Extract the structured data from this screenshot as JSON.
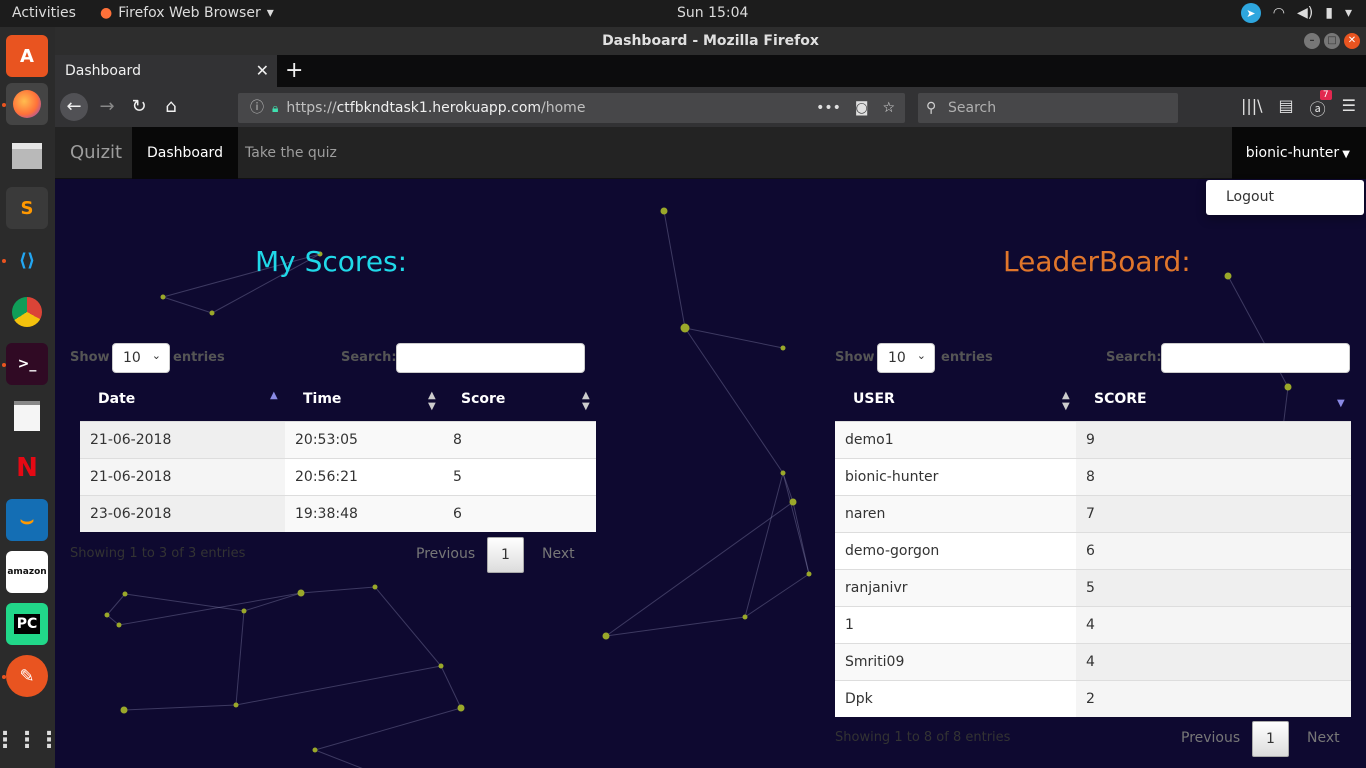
{
  "desktop": {
    "activities": "Activities",
    "app_menu": "Firefox Web Browser",
    "clock": "Sun 15:04"
  },
  "firefox": {
    "window_title": "Dashboard - Mozilla Firefox",
    "tab_title": "Dashboard",
    "url_scheme": "https://",
    "url_host": "ctfbkndtask1.herokuapp.com",
    "url_path": "/home",
    "search_placeholder": "Search",
    "addon_badge": "7"
  },
  "app": {
    "brand": "Quizit",
    "nav": [
      "Dashboard",
      "Take the quiz"
    ],
    "user": "bionic-hunter",
    "dropdown_logout": "Logout"
  },
  "my_scores": {
    "heading": "My Scores:",
    "show": "Show",
    "entries_count": "10",
    "entries": "entries",
    "search_label": "Search:",
    "columns": [
      "Date",
      "Time",
      "Score"
    ],
    "rows": [
      [
        "21-06-2018",
        "20:53:05",
        "8"
      ],
      [
        "21-06-2018",
        "20:56:21",
        "5"
      ],
      [
        "23-06-2018",
        "19:38:48",
        "6"
      ]
    ],
    "info": "Showing 1 to 3 of 3 entries",
    "previous": "Previous",
    "page": "1",
    "next": "Next"
  },
  "leaderboard": {
    "heading": "LeaderBoard:",
    "show": "Show",
    "entries_count": "10",
    "entries": "entries",
    "search_label": "Search:",
    "columns": [
      "USER",
      "SCORE"
    ],
    "rows": [
      [
        "demo1",
        "9"
      ],
      [
        "bionic-hunter",
        "8"
      ],
      [
        "naren",
        "7"
      ],
      [
        "demo-gorgon",
        "6"
      ],
      [
        "ranjanivr",
        "5"
      ],
      [
        "1",
        "4"
      ],
      [
        "Smriti09",
        "4"
      ],
      [
        "Dpk",
        "2"
      ]
    ],
    "info": "Showing 1 to 8 of 8 entries",
    "previous": "Previous",
    "page": "1",
    "next": "Next"
  },
  "colors": {
    "page_bg": "#0e0930",
    "my_scores_heading": "#20d9e9",
    "leaderboard_heading": "#e0762b",
    "node": "#9aa82a"
  }
}
